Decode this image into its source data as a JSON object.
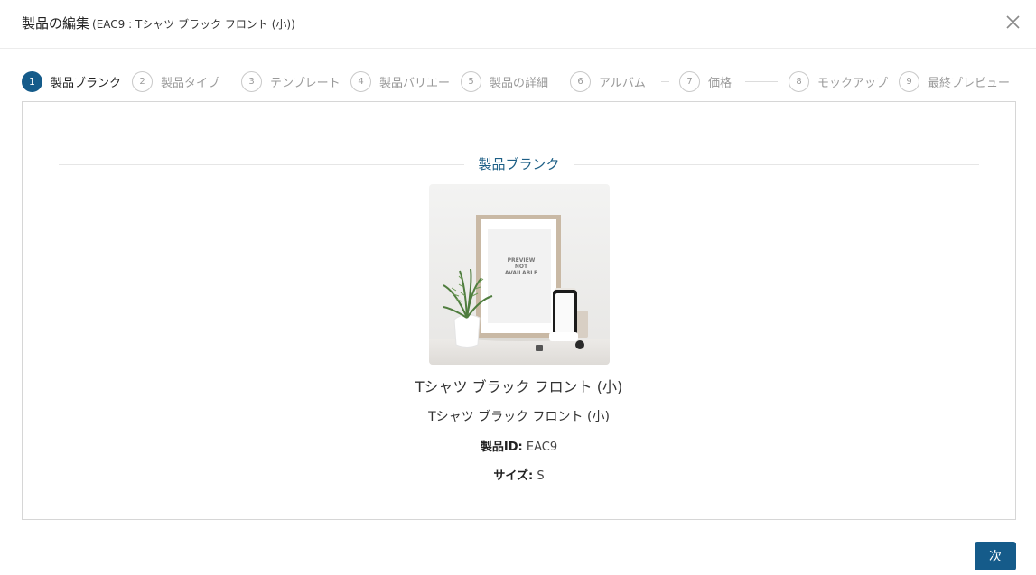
{
  "header": {
    "title": "製品の編集",
    "subtitle": "(EAC9 : Tシャツ ブラック フロント (小))",
    "close_icon": "close-icon"
  },
  "stepper": {
    "steps": [
      {
        "num": "1",
        "label": "製品ブランク",
        "active": true
      },
      {
        "num": "2",
        "label": "製品タイプ",
        "active": false
      },
      {
        "num": "3",
        "label": "テンプレート",
        "active": false
      },
      {
        "num": "4",
        "label": "製品バリエーション",
        "active": false
      },
      {
        "num": "5",
        "label": "製品の詳細",
        "active": false
      },
      {
        "num": "6",
        "label": "アルバム",
        "active": false
      },
      {
        "num": "7",
        "label": "価格",
        "active": false
      },
      {
        "num": "8",
        "label": "モックアップ",
        "active": false
      },
      {
        "num": "9",
        "label": "最終プレビュー",
        "active": false
      }
    ]
  },
  "section": {
    "heading": "製品ブランク",
    "image_text": "PREVIEW NOT AVAILABLE",
    "product_name": "Tシャツ ブラック フロント (小)",
    "product_subname": "Tシャツ ブラック フロント (小)",
    "id_label": "製品ID:",
    "id_value": "EAC9",
    "size_label": "サイズ:",
    "size_value": "S"
  },
  "footer": {
    "next_label": "次"
  },
  "colors": {
    "accent": "#155b8a",
    "heading": "#1d5f86"
  }
}
